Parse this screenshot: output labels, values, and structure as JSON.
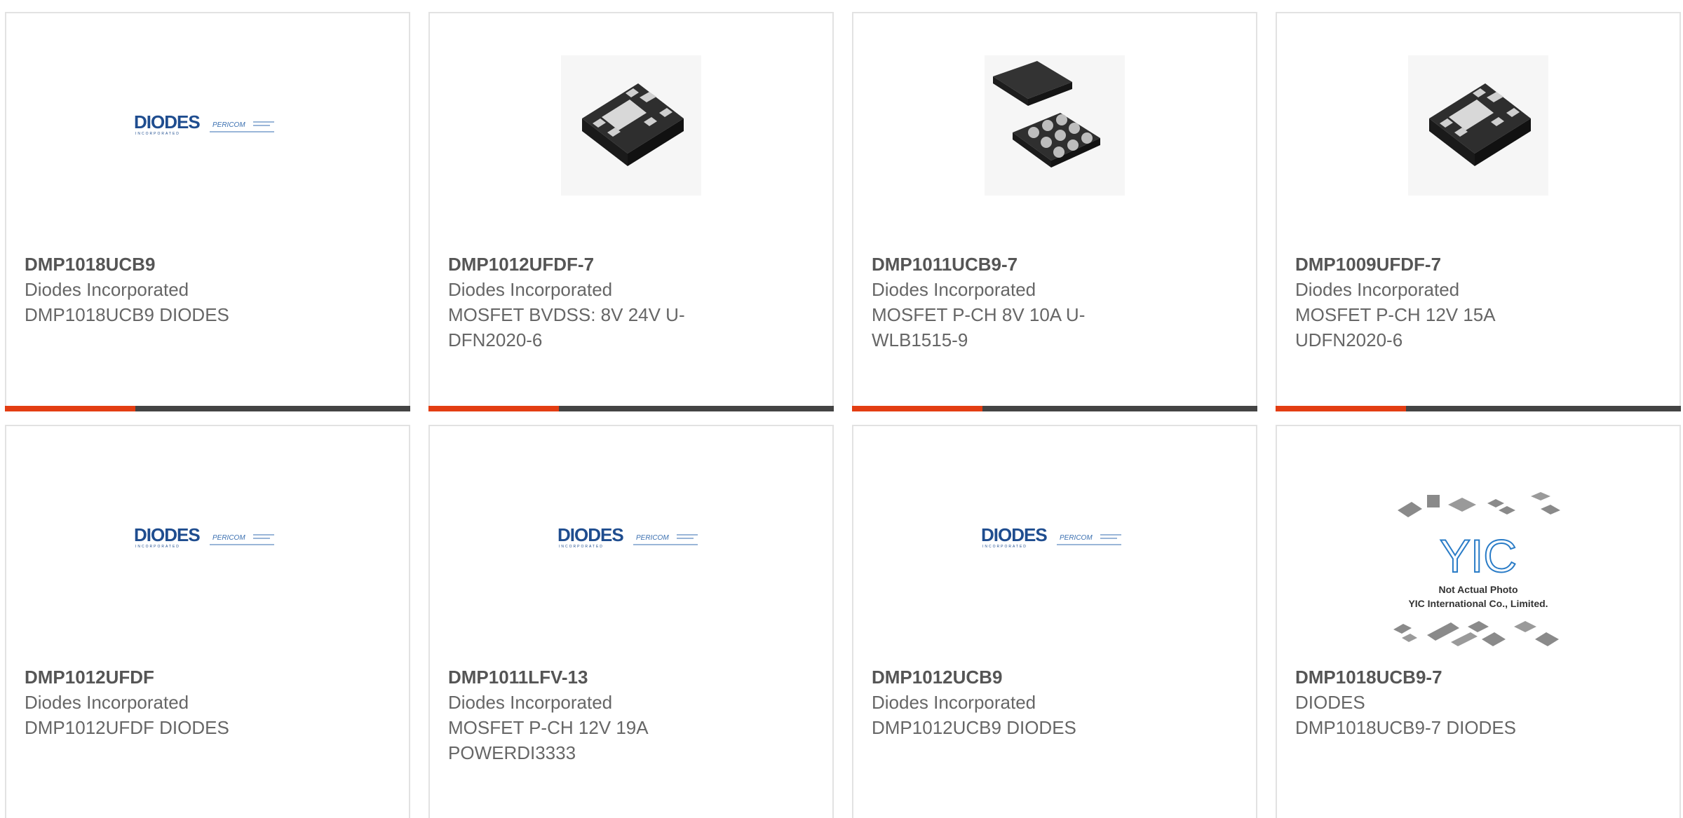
{
  "accent_color": "#e33d12",
  "bar_color": "#444444",
  "products": [
    {
      "part": "DMP1018UCB9",
      "manufacturer": "Diodes Incorporated",
      "description": "DMP1018UCB9 DIODES",
      "image": "diodes-pericom-logo"
    },
    {
      "part": "DMP1012UFDF-7",
      "manufacturer": "Diodes Incorporated",
      "description": "MOSFET BVDSS: 8V 24V U-\nDFN2020-6",
      "image": "dfn6-chip"
    },
    {
      "part": "DMP1011UCB9-7",
      "manufacturer": "Diodes Incorporated",
      "description": "MOSFET P-CH 8V 10A U-\nWLB1515-9",
      "image": "wlb9-bga-chip"
    },
    {
      "part": "DMP1009UFDF-7",
      "manufacturer": "Diodes Incorporated",
      "description": "MOSFET P-CH 12V 15A\nUDFN2020-6",
      "image": "dfn6-chip"
    },
    {
      "part": "DMP1012UFDF",
      "manufacturer": "Diodes Incorporated",
      "description": "DMP1012UFDF DIODES",
      "image": "diodes-pericom-logo"
    },
    {
      "part": "DMP1011LFV-13",
      "manufacturer": "Diodes Incorporated",
      "description": "MOSFET P-CH 12V 19A\nPOWERDI3333",
      "image": "diodes-pericom-logo"
    },
    {
      "part": "DMP1012UCB9",
      "manufacturer": "Diodes Incorporated",
      "description": "DMP1012UCB9 DIODES",
      "image": "diodes-pericom-logo"
    },
    {
      "part": "DMP1018UCB9-7",
      "manufacturer": "DIODES",
      "description": "DMP1018UCB9-7 DIODES",
      "image": "yic-placeholder",
      "placeholder_caption": "Not Actual Photo\nYIC International Co., Limited."
    }
  ],
  "logos": {
    "diodes": "DIODES",
    "diodes_sub": "INCORPORATED",
    "pericom": "PERICOM",
    "yic": "YIC"
  }
}
